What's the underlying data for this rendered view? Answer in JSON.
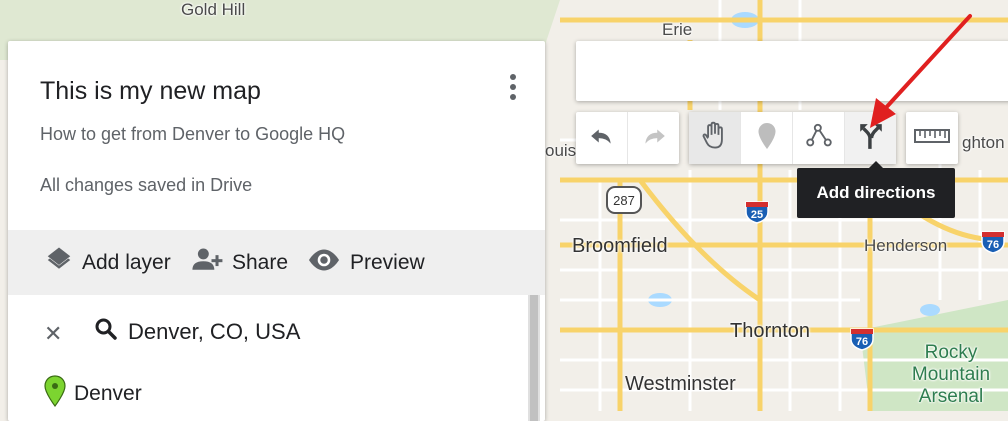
{
  "map": {
    "places": [
      "Gold Hill",
      "Erie",
      "Broomfield",
      "Henderson",
      "Thornton",
      "Westminster",
      "Rocky Mountain Arsenal",
      "ouis",
      "ghton"
    ],
    "highway_shields": [
      "287",
      "25",
      "76",
      "76"
    ]
  },
  "panel": {
    "title": "This is my new map",
    "subtitle": "How to get from Denver to Google HQ",
    "save_status": "All changes saved in Drive",
    "actions": {
      "add_layer": "Add layer",
      "share": "Share",
      "preview": "Preview"
    },
    "layer": {
      "search_text": "Denver, CO, USA",
      "place_name": "Denver"
    }
  },
  "search": {
    "value": ""
  },
  "toolbar": {
    "tools": [
      "undo-icon",
      "redo-icon",
      "hand-icon",
      "marker-icon",
      "draw-line-icon",
      "directions-icon",
      "ruler-icon"
    ],
    "tooltip": "Add directions"
  },
  "colors": {
    "marker_green": "#7cd430",
    "annotation_arrow": "#e02020",
    "road_yellow": "#f8d36a"
  }
}
